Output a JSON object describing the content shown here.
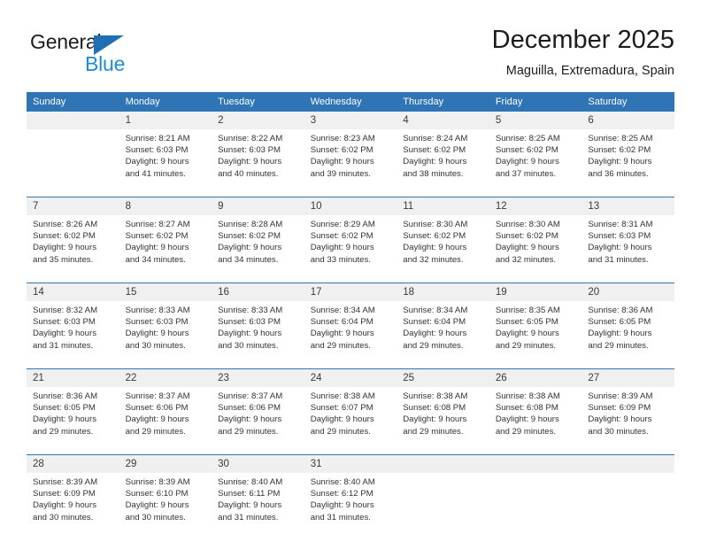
{
  "brand": {
    "name_top": "General",
    "name_bottom": "Blue",
    "triangle_color": "#1f6fb5",
    "blue_color": "#1f8ad6"
  },
  "header": {
    "title": "December 2025",
    "subtitle": "Maguilla, Extremadura, Spain"
  },
  "colors": {
    "header_blue": "#2f74b5",
    "daynum_band": "#f0f0f0",
    "text": "#333333"
  },
  "weekdays": [
    "Sunday",
    "Monday",
    "Tuesday",
    "Wednesday",
    "Thursday",
    "Friday",
    "Saturday"
  ],
  "weeks": [
    [
      {
        "day": ""
      },
      {
        "day": "1",
        "sunrise": "Sunrise: 8:21 AM",
        "sunset": "Sunset: 6:03 PM",
        "daylight1": "Daylight: 9 hours",
        "daylight2": "and 41 minutes."
      },
      {
        "day": "2",
        "sunrise": "Sunrise: 8:22 AM",
        "sunset": "Sunset: 6:03 PM",
        "daylight1": "Daylight: 9 hours",
        "daylight2": "and 40 minutes."
      },
      {
        "day": "3",
        "sunrise": "Sunrise: 8:23 AM",
        "sunset": "Sunset: 6:02 PM",
        "daylight1": "Daylight: 9 hours",
        "daylight2": "and 39 minutes."
      },
      {
        "day": "4",
        "sunrise": "Sunrise: 8:24 AM",
        "sunset": "Sunset: 6:02 PM",
        "daylight1": "Daylight: 9 hours",
        "daylight2": "and 38 minutes."
      },
      {
        "day": "5",
        "sunrise": "Sunrise: 8:25 AM",
        "sunset": "Sunset: 6:02 PM",
        "daylight1": "Daylight: 9 hours",
        "daylight2": "and 37 minutes."
      },
      {
        "day": "6",
        "sunrise": "Sunrise: 8:25 AM",
        "sunset": "Sunset: 6:02 PM",
        "daylight1": "Daylight: 9 hours",
        "daylight2": "and 36 minutes."
      }
    ],
    [
      {
        "day": "7",
        "sunrise": "Sunrise: 8:26 AM",
        "sunset": "Sunset: 6:02 PM",
        "daylight1": "Daylight: 9 hours",
        "daylight2": "and 35 minutes."
      },
      {
        "day": "8",
        "sunrise": "Sunrise: 8:27 AM",
        "sunset": "Sunset: 6:02 PM",
        "daylight1": "Daylight: 9 hours",
        "daylight2": "and 34 minutes."
      },
      {
        "day": "9",
        "sunrise": "Sunrise: 8:28 AM",
        "sunset": "Sunset: 6:02 PM",
        "daylight1": "Daylight: 9 hours",
        "daylight2": "and 34 minutes."
      },
      {
        "day": "10",
        "sunrise": "Sunrise: 8:29 AM",
        "sunset": "Sunset: 6:02 PM",
        "daylight1": "Daylight: 9 hours",
        "daylight2": "and 33 minutes."
      },
      {
        "day": "11",
        "sunrise": "Sunrise: 8:30 AM",
        "sunset": "Sunset: 6:02 PM",
        "daylight1": "Daylight: 9 hours",
        "daylight2": "and 32 minutes."
      },
      {
        "day": "12",
        "sunrise": "Sunrise: 8:30 AM",
        "sunset": "Sunset: 6:02 PM",
        "daylight1": "Daylight: 9 hours",
        "daylight2": "and 32 minutes."
      },
      {
        "day": "13",
        "sunrise": "Sunrise: 8:31 AM",
        "sunset": "Sunset: 6:03 PM",
        "daylight1": "Daylight: 9 hours",
        "daylight2": "and 31 minutes."
      }
    ],
    [
      {
        "day": "14",
        "sunrise": "Sunrise: 8:32 AM",
        "sunset": "Sunset: 6:03 PM",
        "daylight1": "Daylight: 9 hours",
        "daylight2": "and 31 minutes."
      },
      {
        "day": "15",
        "sunrise": "Sunrise: 8:33 AM",
        "sunset": "Sunset: 6:03 PM",
        "daylight1": "Daylight: 9 hours",
        "daylight2": "and 30 minutes."
      },
      {
        "day": "16",
        "sunrise": "Sunrise: 8:33 AM",
        "sunset": "Sunset: 6:03 PM",
        "daylight1": "Daylight: 9 hours",
        "daylight2": "and 30 minutes."
      },
      {
        "day": "17",
        "sunrise": "Sunrise: 8:34 AM",
        "sunset": "Sunset: 6:04 PM",
        "daylight1": "Daylight: 9 hours",
        "daylight2": "and 29 minutes."
      },
      {
        "day": "18",
        "sunrise": "Sunrise: 8:34 AM",
        "sunset": "Sunset: 6:04 PM",
        "daylight1": "Daylight: 9 hours",
        "daylight2": "and 29 minutes."
      },
      {
        "day": "19",
        "sunrise": "Sunrise: 8:35 AM",
        "sunset": "Sunset: 6:05 PM",
        "daylight1": "Daylight: 9 hours",
        "daylight2": "and 29 minutes."
      },
      {
        "day": "20",
        "sunrise": "Sunrise: 8:36 AM",
        "sunset": "Sunset: 6:05 PM",
        "daylight1": "Daylight: 9 hours",
        "daylight2": "and 29 minutes."
      }
    ],
    [
      {
        "day": "21",
        "sunrise": "Sunrise: 8:36 AM",
        "sunset": "Sunset: 6:05 PM",
        "daylight1": "Daylight: 9 hours",
        "daylight2": "and 29 minutes."
      },
      {
        "day": "22",
        "sunrise": "Sunrise: 8:37 AM",
        "sunset": "Sunset: 6:06 PM",
        "daylight1": "Daylight: 9 hours",
        "daylight2": "and 29 minutes."
      },
      {
        "day": "23",
        "sunrise": "Sunrise: 8:37 AM",
        "sunset": "Sunset: 6:06 PM",
        "daylight1": "Daylight: 9 hours",
        "daylight2": "and 29 minutes."
      },
      {
        "day": "24",
        "sunrise": "Sunrise: 8:38 AM",
        "sunset": "Sunset: 6:07 PM",
        "daylight1": "Daylight: 9 hours",
        "daylight2": "and 29 minutes."
      },
      {
        "day": "25",
        "sunrise": "Sunrise: 8:38 AM",
        "sunset": "Sunset: 6:08 PM",
        "daylight1": "Daylight: 9 hours",
        "daylight2": "and 29 minutes."
      },
      {
        "day": "26",
        "sunrise": "Sunrise: 8:38 AM",
        "sunset": "Sunset: 6:08 PM",
        "daylight1": "Daylight: 9 hours",
        "daylight2": "and 29 minutes."
      },
      {
        "day": "27",
        "sunrise": "Sunrise: 8:39 AM",
        "sunset": "Sunset: 6:09 PM",
        "daylight1": "Daylight: 9 hours",
        "daylight2": "and 30 minutes."
      }
    ],
    [
      {
        "day": "28",
        "sunrise": "Sunrise: 8:39 AM",
        "sunset": "Sunset: 6:09 PM",
        "daylight1": "Daylight: 9 hours",
        "daylight2": "and 30 minutes."
      },
      {
        "day": "29",
        "sunrise": "Sunrise: 8:39 AM",
        "sunset": "Sunset: 6:10 PM",
        "daylight1": "Daylight: 9 hours",
        "daylight2": "and 30 minutes."
      },
      {
        "day": "30",
        "sunrise": "Sunrise: 8:40 AM",
        "sunset": "Sunset: 6:11 PM",
        "daylight1": "Daylight: 9 hours",
        "daylight2": "and 31 minutes."
      },
      {
        "day": "31",
        "sunrise": "Sunrise: 8:40 AM",
        "sunset": "Sunset: 6:12 PM",
        "daylight1": "Daylight: 9 hours",
        "daylight2": "and 31 minutes."
      },
      {
        "day": ""
      },
      {
        "day": ""
      },
      {
        "day": ""
      }
    ]
  ]
}
